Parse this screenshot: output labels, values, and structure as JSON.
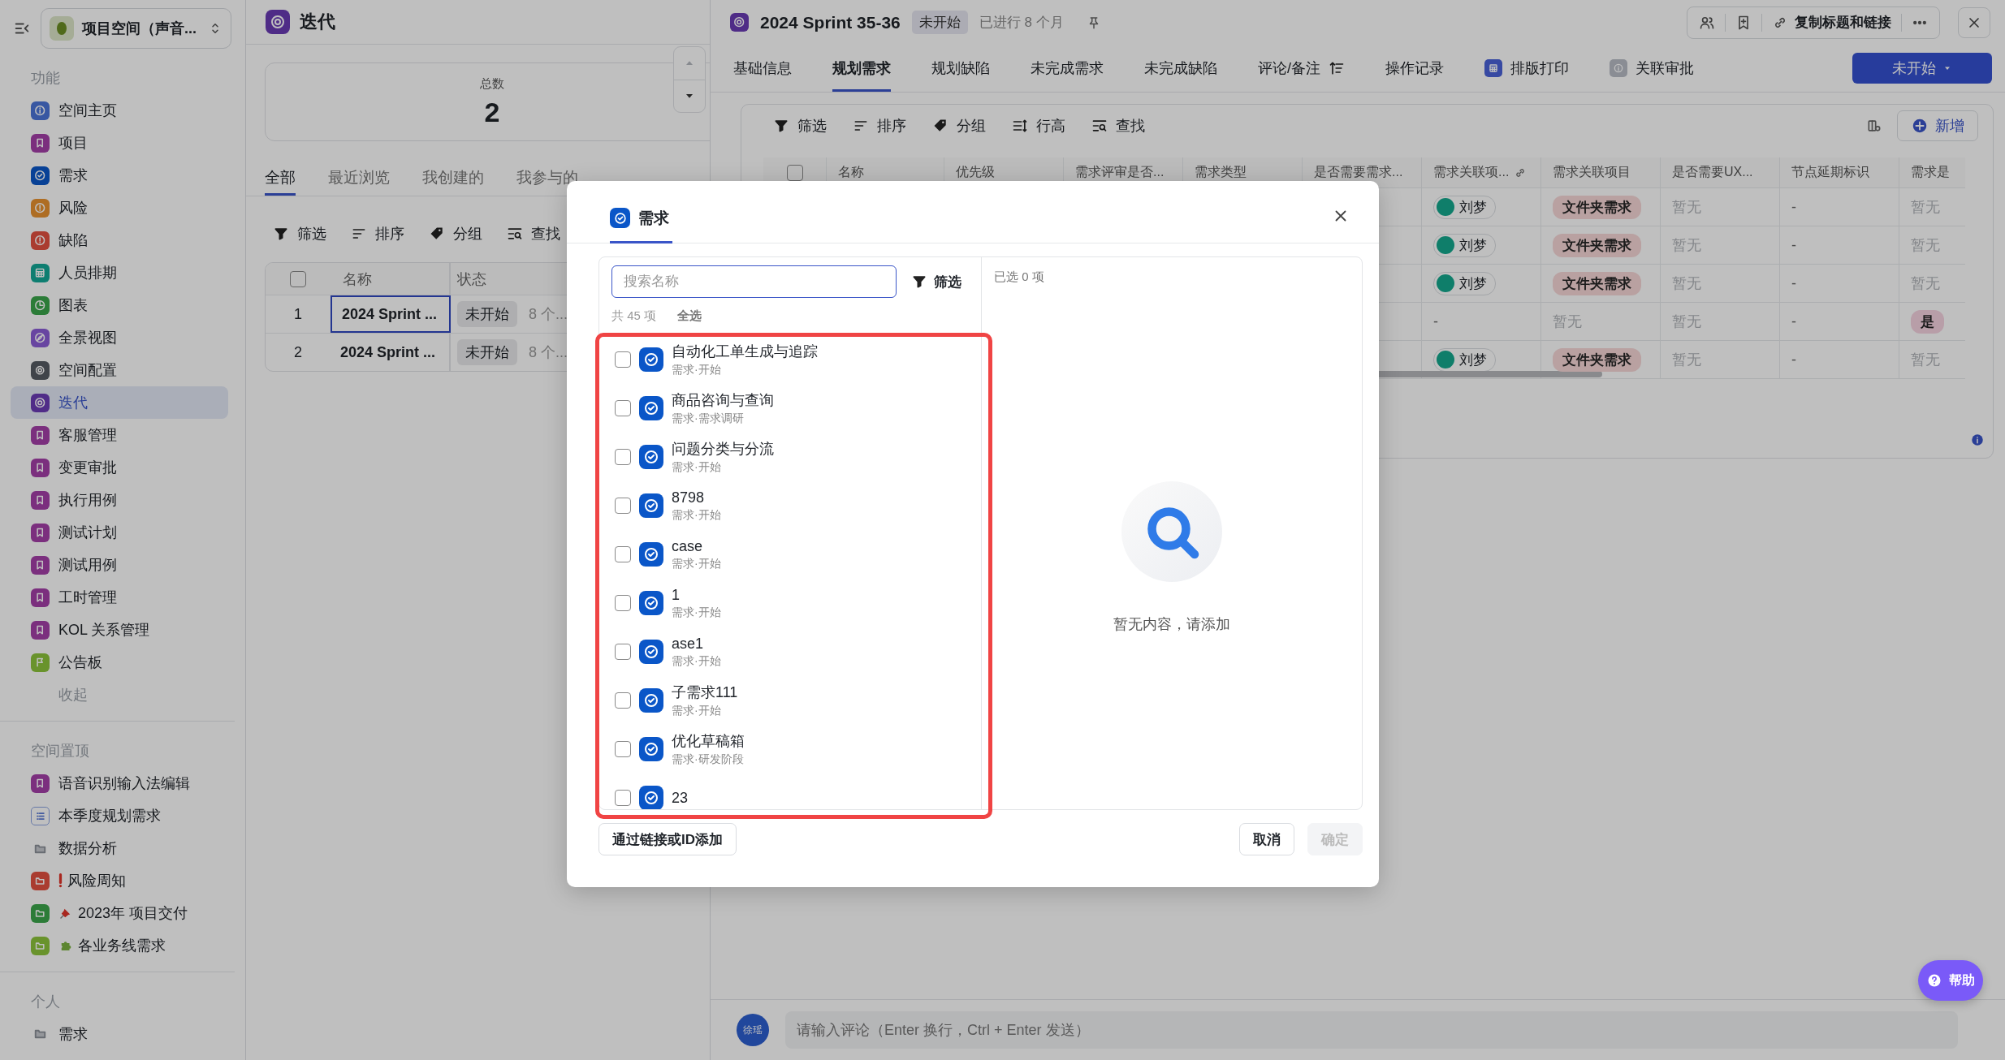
{
  "sidebar": {
    "workspace": "项目空间（声音...",
    "sections": [
      {
        "title": "功能",
        "footer": "收起",
        "items": [
          {
            "label": "空间主页",
            "kind": "info",
            "color": "#3857a2",
            "selected": false
          },
          {
            "label": "项目",
            "kind": "bookmark",
            "color": "#7b2f7e",
            "selected": false
          },
          {
            "label": "需求",
            "kind": "check",
            "color": "#084196",
            "selected": false
          },
          {
            "label": "风险",
            "kind": "alert",
            "color": "#ae6d23",
            "selected": false
          },
          {
            "label": "缺陷",
            "kind": "alert",
            "color": "#aa3c30",
            "selected": false
          },
          {
            "label": "人员排期",
            "kind": "grid",
            "color": "#0e7e71",
            "selected": false
          },
          {
            "label": "图表",
            "kind": "clock",
            "color": "#2c7c38",
            "selected": false
          },
          {
            "label": "全景视图",
            "kind": "compass",
            "color": "#6845a1",
            "selected": false
          },
          {
            "label": "空间配置",
            "kind": "gear",
            "color": "#40444a",
            "selected": false
          },
          {
            "label": "迭代",
            "kind": "cycle",
            "color": "#502c88",
            "selected": true
          },
          {
            "label": "客服管理",
            "kind": "bookmark",
            "color": "#7b2f7e",
            "selected": false
          },
          {
            "label": "变更审批",
            "kind": "bookmark",
            "color": "#7b2f7e",
            "selected": false
          },
          {
            "label": "执行用例",
            "kind": "bookmark",
            "color": "#7b2f7e",
            "selected": false
          },
          {
            "label": "测试计划",
            "kind": "bookmark",
            "color": "#7b2f7e",
            "selected": false
          },
          {
            "label": "测试用例",
            "kind": "bookmark",
            "color": "#7b2f7e",
            "selected": false
          },
          {
            "label": "工时管理",
            "kind": "bookmark",
            "color": "#7b2f7e",
            "selected": false
          },
          {
            "label": "KOL 关系管理",
            "kind": "bookmark",
            "color": "#7b2f7e",
            "selected": false
          },
          {
            "label": "公告板",
            "kind": "flag",
            "color": "#69932c",
            "selected": false
          }
        ]
      },
      {
        "title": "空间置顶",
        "items": [
          {
            "label": "语音识别输入法编辑",
            "kind": "bookmark",
            "color": "#7b2f7e",
            "selected": false
          },
          {
            "label": "本季度规划需求",
            "kind": "list",
            "selected": false
          },
          {
            "label": "数据分析",
            "kind": "folder",
            "selected": false
          },
          {
            "label": "风险周知",
            "kind": "folder-tile",
            "color": "#aa3c30",
            "emoji": {
              "kind": "exclamation"
            },
            "selected": false
          },
          {
            "label": "2023年 项目交付",
            "kind": "folder-tile",
            "color": "#2c7c38",
            "emoji": {
              "kind": "pin"
            },
            "selected": false
          },
          {
            "label": "各业务线需求",
            "kind": "folder-tile",
            "color": "#69932c",
            "emoji": {
              "kind": "puzzle"
            },
            "selected": false
          }
        ]
      },
      {
        "title": "个人",
        "items": [
          {
            "label": "需求",
            "kind": "folder",
            "selected": false
          }
        ]
      }
    ]
  },
  "list_panel": {
    "title": "迭代",
    "stat": {
      "label": "总数",
      "value": "2"
    },
    "tabs": [
      {
        "label": "全部",
        "selected": true
      },
      {
        "label": "最近浏览",
        "selected": false
      },
      {
        "label": "我创建的",
        "selected": false
      },
      {
        "label": "我参与的",
        "selected": false
      }
    ],
    "toolbar": [
      {
        "kind": "filter",
        "label": "筛选"
      },
      {
        "kind": "sort",
        "label": "排序"
      },
      {
        "kind": "group",
        "label": "分组"
      },
      {
        "kind": "find",
        "label": "查找"
      }
    ],
    "table": {
      "header_checked": false,
      "columns": [
        "名称",
        "状态"
      ],
      "rows": [
        {
          "index": "1",
          "name": "2024 Sprint ...",
          "status": "未开始",
          "column_3": "8 个...",
          "selected": true
        },
        {
          "index": "2",
          "name": "2024 Sprint ...",
          "status": "未开始",
          "column_3": "8 个...",
          "selected": false
        }
      ]
    }
  },
  "detail": {
    "title": "2024 Sprint 35-36",
    "status": "未开始",
    "elapsed": "已进行 8 个月",
    "copy_link": "复制标题和链接",
    "tabs": [
      {
        "label": "基础信息",
        "kind": "text",
        "selected": false
      },
      {
        "label": "规划需求",
        "kind": "text",
        "selected": true
      },
      {
        "label": "规划缺陷",
        "kind": "text",
        "selected": false
      },
      {
        "label": "未完成需求",
        "kind": "text",
        "selected": false
      },
      {
        "label": "未完成缺陷",
        "kind": "text",
        "selected": false
      },
      {
        "label": "评论/备注",
        "kind": "sort",
        "selected": false
      },
      {
        "label": "操作记录",
        "kind": "text",
        "selected": false
      },
      {
        "label": "排版打印",
        "kind": "print",
        "selected": false
      },
      {
        "label": "关联审批",
        "kind": "approval",
        "selected": false
      }
    ],
    "status_button": "未开始",
    "toolbar": [
      {
        "kind": "filter",
        "label": "筛选"
      },
      {
        "kind": "sort",
        "label": "排序"
      },
      {
        "kind": "group",
        "label": "分组"
      },
      {
        "kind": "row-height",
        "label": "行高"
      },
      {
        "kind": "find",
        "label": "查找"
      }
    ],
    "add_button": "新增",
    "table": {
      "header_checked": false,
      "columns": [
        {
          "label": "名称",
          "kind": "text"
        },
        {
          "label": "优先级",
          "kind": "text"
        },
        {
          "label": "需求评审是否...",
          "kind": "text"
        },
        {
          "label": "需求类型",
          "kind": "text"
        },
        {
          "label": "是否需要需求...",
          "kind": "text"
        },
        {
          "label": "需求关联项...",
          "kind": "linked"
        },
        {
          "label": "需求关联项目",
          "kind": "text"
        },
        {
          "label": "是否需要UX...",
          "kind": "text"
        },
        {
          "label": "节点延期标识",
          "kind": "text"
        },
        {
          "label": "需求是",
          "kind": "text"
        }
      ],
      "rows": [
        {
          "cells": [
            "",
            "",
            "",
            "",
            "",
            {
              "kind": "person",
              "text": "刘梦"
            },
            {
              "kind": "tag",
              "text": "文件夹需求",
              "color": "#b9a1a1"
            },
            {
              "kind": "muted",
              "text": "暂无"
            },
            {
              "kind": "text",
              "text": "-"
            },
            {
              "kind": "muted",
              "text": "暂无"
            }
          ]
        },
        {
          "cells": [
            "",
            "",
            "",
            "",
            "",
            {
              "kind": "person",
              "text": "刘梦"
            },
            {
              "kind": "tag",
              "text": "文件夹需求",
              "color": "#b9a1a1"
            },
            {
              "kind": "muted",
              "text": "暂无"
            },
            {
              "kind": "text",
              "text": "-"
            },
            {
              "kind": "muted",
              "text": "暂无"
            }
          ]
        },
        {
          "cells": [
            "",
            "",
            "",
            "",
            "",
            {
              "kind": "person",
              "text": "刘梦"
            },
            {
              "kind": "tag",
              "text": "文件夹需求",
              "color": "#b9a1a1"
            },
            {
              "kind": "muted",
              "text": "暂无"
            },
            {
              "kind": "text",
              "text": "-"
            },
            {
              "kind": "muted",
              "text": "暂无"
            }
          ]
        },
        {
          "cells": [
            "",
            "",
            "",
            "",
            "",
            {
              "kind": "text",
              "text": "-"
            },
            {
              "kind": "muted",
              "text": "暂无"
            },
            {
              "kind": "muted",
              "text": "暂无"
            },
            {
              "kind": "text",
              "text": "-"
            },
            {
              "kind": "tag",
              "text": "是",
              "color": "#b89ea8"
            }
          ]
        },
        {
          "cells": [
            "",
            "",
            "",
            "",
            "",
            {
              "kind": "person",
              "text": "刘梦"
            },
            {
              "kind": "tag",
              "text": "文件夹需求",
              "color": "#b9a1a1"
            },
            {
              "kind": "muted",
              "text": "暂无"
            },
            {
              "kind": "text",
              "text": "-"
            },
            {
              "kind": "muted",
              "text": "暂无"
            }
          ]
        }
      ]
    },
    "comment": {
      "avatar": "徐瑶",
      "placeholder": "请输入评论（Enter 换行，Ctrl + Enter 发送）"
    }
  },
  "dialog": {
    "tab": "需求",
    "search_placeholder": "搜索名称",
    "filter": "筛选",
    "total": "共 45 项",
    "select_all": "全选",
    "selected_count": "已选 0 项",
    "empty_text": "暂无内容，请添加",
    "items": [
      {
        "title": "自动化工单生成与追踪",
        "subtitle": "需求·开始",
        "checked": false
      },
      {
        "title": "商品咨询与查询",
        "subtitle": "需求·需求调研",
        "checked": false
      },
      {
        "title": "问题分类与分流",
        "subtitle": "需求·开始",
        "checked": false
      },
      {
        "title": "8798",
        "subtitle": "需求·开始",
        "checked": false
      },
      {
        "title": "case",
        "subtitle": "需求·开始",
        "checked": false
      },
      {
        "title": "1",
        "subtitle": "需求·开始",
        "checked": false
      },
      {
        "title": "ase1",
        "subtitle": "需求·开始",
        "checked": false
      },
      {
        "title": "子需求111",
        "subtitle": "需求·开始",
        "checked": false
      },
      {
        "title": "优化草稿箱",
        "subtitle": "需求·研发阶段",
        "checked": false
      },
      {
        "title": "23",
        "checked": false
      }
    ],
    "link_button": "通过链接或ID添加",
    "cancel": "取消",
    "confirm": "确定",
    "confirm_disabled": true
  },
  "help": "帮助"
}
